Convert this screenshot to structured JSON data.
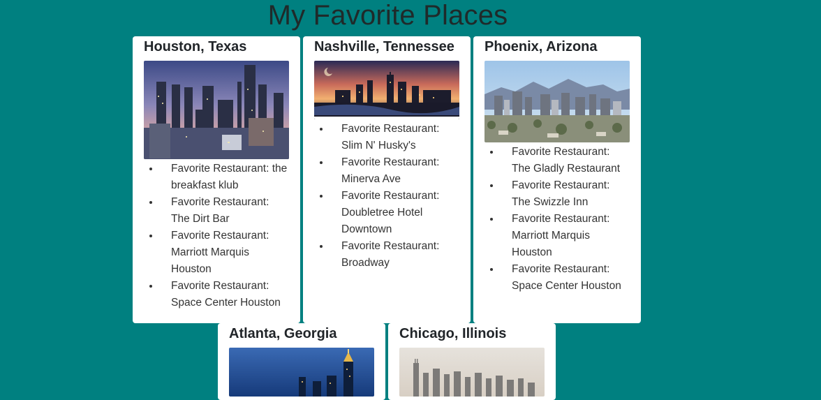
{
  "page": {
    "title": "My Favorite Places",
    "background_color": "#008080"
  },
  "cards": [
    {
      "title": "Houston, Texas",
      "image": "houston-skyline-dusk",
      "items": [
        "Favorite Restaurant: the breakfast klub",
        "Favorite Restaurant: The Dirt Bar",
        "Favorite Restaurant: Marriott Marquis Houston",
        "Favorite Restaurant: Space Center Houston"
      ]
    },
    {
      "title": "Nashville, Tennessee",
      "image": "nashville-skyline-sunset",
      "items": [
        "Favorite Restaurant: Slim N' Husky's",
        "Favorite Restaurant: Minerva Ave",
        "Favorite Restaurant: Doubletree Hotel Downtown",
        "Favorite Restaurant: Broadway"
      ]
    },
    {
      "title": "Phoenix, Arizona",
      "image": "phoenix-skyline-mountains",
      "items": [
        "Favorite Restaurant: The Gladly Restaurant",
        "Favorite Restaurant: The Swizzle Inn",
        "Favorite Restaurant: Marriott Marquis Houston",
        "Favorite Restaurant: Space Center Houston"
      ]
    },
    {
      "title": "Atlanta, Georgia",
      "image": "atlanta-skyline-night",
      "items": []
    },
    {
      "title": "Chicago, Illinois",
      "image": "chicago-skyline-day",
      "items": []
    }
  ]
}
